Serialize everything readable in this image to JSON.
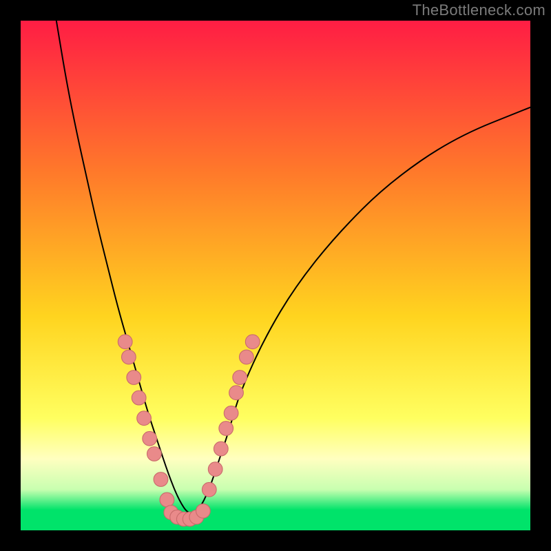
{
  "watermark": "TheBottleneck.com",
  "colors": {
    "bg_border": "#000000",
    "grad_top": "#ff1d44",
    "grad_mid_upper": "#ff7a2a",
    "grad_mid": "#ffd41f",
    "grad_mid_lower": "#ffff60",
    "grad_pale": "#ffffc0",
    "grad_green_soft": "#c8ffb0",
    "grad_green": "#00e36a",
    "curve": "#000000",
    "marker_fill": "#e98a8a",
    "marker_stroke": "#c96b6b"
  },
  "chart_data": {
    "type": "line",
    "title": "",
    "xlabel": "",
    "ylabel": "",
    "xlim": [
      0,
      100
    ],
    "ylim": [
      0,
      100
    ],
    "note": "Axes are percentage of plot area; no numeric tick labels are displayed in the image. Y increases downward visually (0 at top, 100 at bottom). Values are visual estimates.",
    "series": [
      {
        "name": "bottleneck-curve",
        "x": [
          7,
          9,
          11,
          13,
          15,
          17,
          19,
          21,
          23,
          25,
          27,
          29,
          31,
          33,
          35,
          37,
          39,
          41,
          43,
          48,
          54,
          62,
          72,
          85,
          100
        ],
        "y": [
          0,
          12,
          22,
          31,
          40,
          48,
          56,
          63,
          70,
          77,
          83,
          89,
          94,
          97,
          96,
          92,
          86,
          80,
          73,
          62,
          52,
          42,
          32,
          23,
          17
        ]
      }
    ],
    "markers": [
      {
        "name": "left-cluster",
        "points": [
          {
            "x": 20.5,
            "y": 63
          },
          {
            "x": 21.2,
            "y": 66
          },
          {
            "x": 22.2,
            "y": 70
          },
          {
            "x": 23.2,
            "y": 74
          },
          {
            "x": 24.2,
            "y": 78
          },
          {
            "x": 25.3,
            "y": 82
          },
          {
            "x": 26.2,
            "y": 85
          },
          {
            "x": 27.5,
            "y": 90
          },
          {
            "x": 28.7,
            "y": 94
          }
        ]
      },
      {
        "name": "right-cluster",
        "points": [
          {
            "x": 37.0,
            "y": 92
          },
          {
            "x": 38.2,
            "y": 88
          },
          {
            "x": 39.3,
            "y": 84
          },
          {
            "x": 40.3,
            "y": 80
          },
          {
            "x": 41.3,
            "y": 77
          },
          {
            "x": 42.3,
            "y": 73
          },
          {
            "x": 43.0,
            "y": 70
          },
          {
            "x": 44.3,
            "y": 66
          },
          {
            "x": 45.5,
            "y": 63
          }
        ]
      },
      {
        "name": "bottom-cluster",
        "points": [
          {
            "x": 29.5,
            "y": 96.5
          },
          {
            "x": 30.7,
            "y": 97.4
          },
          {
            "x": 32.0,
            "y": 97.8
          },
          {
            "x": 33.2,
            "y": 97.8
          },
          {
            "x": 34.5,
            "y": 97.4
          },
          {
            "x": 35.8,
            "y": 96.2
          }
        ]
      }
    ],
    "gradient_stops": [
      {
        "offset": 0,
        "color_key": "grad_top"
      },
      {
        "offset": 30,
        "color_key": "grad_mid_upper"
      },
      {
        "offset": 58,
        "color_key": "grad_mid"
      },
      {
        "offset": 78,
        "color_key": "grad_mid_lower"
      },
      {
        "offset": 86,
        "color_key": "grad_pale"
      },
      {
        "offset": 92,
        "color_key": "grad_green_soft"
      },
      {
        "offset": 96,
        "color_key": "grad_green"
      },
      {
        "offset": 100,
        "color_key": "grad_green"
      }
    ]
  }
}
